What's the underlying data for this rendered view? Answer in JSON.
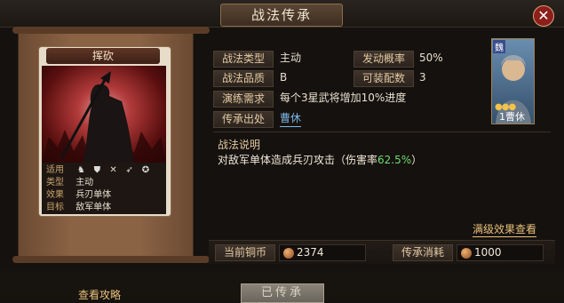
{
  "window": {
    "title": "战法传承",
    "close_label": "✕"
  },
  "card": {
    "name": "挥砍",
    "info": [
      {
        "key": "适用",
        "value": ""
      },
      {
        "key": "类型",
        "value": "主动"
      },
      {
        "key": "效果",
        "value": "兵刃单体"
      },
      {
        "key": "目标",
        "value": "敌军单体"
      }
    ],
    "icons": [
      "cavalry-icon",
      "shield-icon",
      "crossed-swords-icon",
      "bow-icon",
      "wheel-icon"
    ]
  },
  "details": {
    "type_label": "战法类型",
    "type_value": "主动",
    "rate_label": "发动概率",
    "rate_value": "50%",
    "quality_label": "战法品质",
    "quality_value": "B",
    "slots_label": "可装配数",
    "slots_value": "3",
    "practice_label": "演练需求",
    "practice_value": "每个3星武将增加10%进度",
    "source_label": "传承出处",
    "source_value": "曹休"
  },
  "hero": {
    "faction": "魏",
    "name": "1曹休",
    "stars": 3
  },
  "description": {
    "title": "战法说明",
    "text_before": "对敌军单体造成兵刃攻击（伤害率",
    "highlight": "62.5%",
    "text_after": "）"
  },
  "full_effect_label": "满级效果查看",
  "resources": {
    "copper_label": "当前铜币",
    "copper_value": "2374",
    "cost_label": "传承消耗",
    "cost_value": "1000"
  },
  "footer": {
    "strategy_label": "查看攻略",
    "inherit_label": "已传承"
  }
}
